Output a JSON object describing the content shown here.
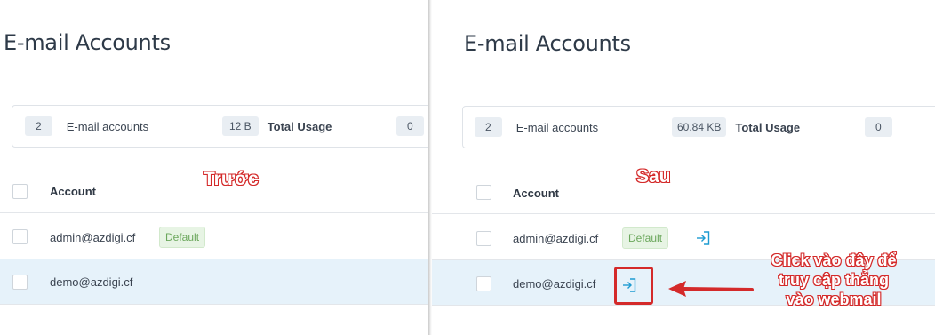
{
  "before": {
    "page_title": "E-mail Accounts",
    "stats": {
      "account_count": "2",
      "accounts_label": "E-mail accounts",
      "usage_value": "12 B",
      "usage_label": "Total Usage",
      "third_value": "0"
    },
    "table": {
      "header_account": "Account",
      "rows": [
        {
          "email": "admin@azdigi.cf",
          "badge": "Default"
        },
        {
          "email": "demo@azdigi.cf"
        }
      ]
    },
    "annotation": "Trước"
  },
  "after": {
    "page_title": "E-mail Accounts",
    "stats": {
      "account_count": "2",
      "accounts_label": "E-mail accounts",
      "usage_value": "60.84 KB",
      "usage_label": "Total Usage",
      "third_value": "0"
    },
    "table": {
      "header_account": "Account",
      "rows": [
        {
          "email": "admin@azdigi.cf",
          "badge": "Default",
          "icon": "webmail-login-icon"
        },
        {
          "email": "demo@azdigi.cf",
          "icon": "webmail-login-icon"
        }
      ]
    },
    "annotation": "Sau",
    "callout": {
      "line1": "Click vào đây để",
      "line2": "truy cập thẳng",
      "line3": "vào webmail"
    }
  },
  "colors": {
    "accent": "#1d9bd1",
    "annotation_red": "#d42a2a",
    "selected_row": "#e6f2fa",
    "default_badge_text": "#6ba75c"
  }
}
